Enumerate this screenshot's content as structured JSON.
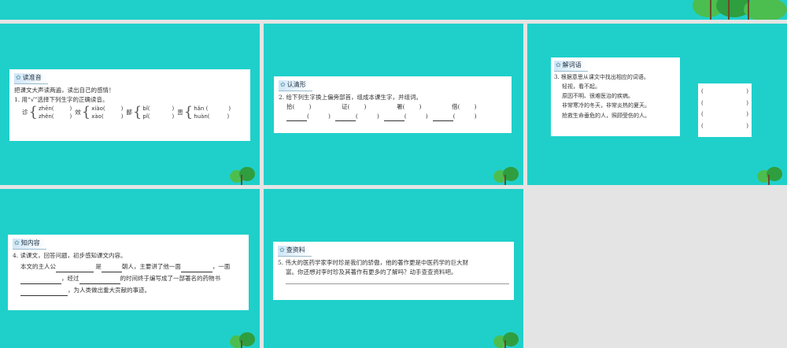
{
  "slide1": {
    "tag": "读准音",
    "line1": "把课文大声读两遍，读出自己的感情！",
    "line2": "1. 用“√”选择下列生字的正确读音。",
    "groups": [
      {
        "char": "诊",
        "a": "zhēn(",
        "b": "zhěn(",
        "close": ")"
      },
      {
        "char": "效",
        "a": "xiào(",
        "b": "xào(",
        "close": ")"
      },
      {
        "char": "鄙",
        "a": "bǐ(",
        "b": "pǐ(",
        "close": ")"
      },
      {
        "char": "患",
        "a": "hǎn (",
        "b": "huàn(",
        "close": ")"
      }
    ]
  },
  "slide2": {
    "tag": "认清形",
    "line1": "2. 给下列生字换上偏旁部首，组成本课生字，并组词。",
    "chars": [
      "拾(",
      "证(",
      "署(",
      "借("
    ],
    "open": "(",
    "close": ")"
  },
  "slide3": {
    "tag": "解词语",
    "line1": "3. 根据意思从课文中找出相应的词语。",
    "items": [
      "轻视，看不起。",
      "原因不明、很难医治的疾病。",
      "非常寒冷的冬天，非常炎热的夏天。",
      "抢救生命垂危的人，照顾受伤的人。"
    ],
    "open": "(",
    "close": ")"
  },
  "slide4": {
    "tag": "知内容",
    "line1": "4. 读课文，回答问题，初步感知课文内容。",
    "p1": "本文的主人公",
    "p2": "是",
    "p3": "朝人，主要讲了他一面",
    "p4": "，一面",
    "p5": "，经过",
    "p6": "的时间终于编写成了一部著名的药物书",
    "p7": "，为人类做出重大贡献的事迹。"
  },
  "slide5": {
    "tag": "查资料",
    "line1": "5. 伟大的医药学家李时珍是我们的骄傲，他的著作更是中医药学的巨大财",
    "line2": "富。你还想对李时珍及其著作有更多的了解吗？动手查查资料吧。"
  },
  "colors": {
    "slide_bg": "#1fd0ca",
    "sorter_bg": "#e4e4e4"
  }
}
